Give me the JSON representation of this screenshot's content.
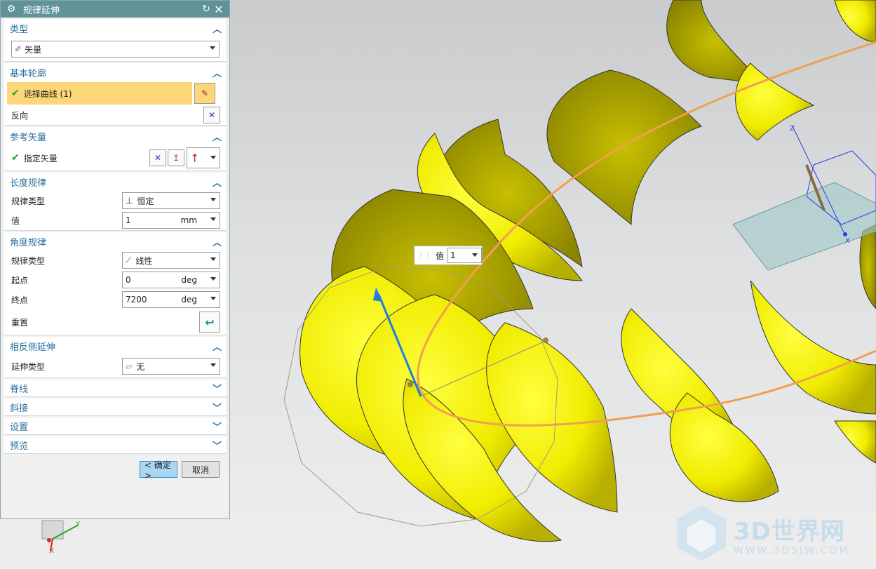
{
  "dialog": {
    "title": "规律延伸",
    "sections": {
      "type": {
        "header": "类型",
        "value": "矢量"
      },
      "base_profile": {
        "header": "基本轮廓",
        "select_curve": "选择曲线 (1)",
        "reverse": "反向"
      },
      "ref_vector": {
        "header": "参考矢量",
        "specify_vector": "指定矢量"
      },
      "length_law": {
        "header": "长度规律",
        "law_type_label": "规律类型",
        "law_type_value": "恒定",
        "value_label": "值",
        "value": "1",
        "unit": "mm"
      },
      "angle_law": {
        "header": "角度规律",
        "law_type_label": "规律类型",
        "law_type_value": "线性",
        "start_label": "起点",
        "start_value": "0",
        "end_label": "终点",
        "end_value": "7200",
        "unit": "deg",
        "reset_label": "重置"
      },
      "opposite_ext": {
        "header": "相反侧延伸",
        "ext_type_label": "延伸类型",
        "ext_type_value": "无"
      },
      "spine": {
        "header": "脊线"
      },
      "taper": {
        "header": "斜接"
      },
      "settings": {
        "header": "设置"
      },
      "preview": {
        "header": "预览"
      }
    },
    "buttons": {
      "ok": "< 确定 >",
      "cancel": "取消"
    }
  },
  "floating_input": {
    "label": "值",
    "value": "1"
  },
  "triad": {
    "x": "X",
    "y": "Y",
    "z": "Z"
  },
  "watermark": {
    "title": "3D世界网",
    "url": "WWW.3DSJW.COM"
  },
  "colors": {
    "titlebar": "#5f9398",
    "header_text": "#2b6f9e",
    "selection": "#fdd679",
    "surface": "#f2ee00",
    "curve": "#f0a050"
  }
}
